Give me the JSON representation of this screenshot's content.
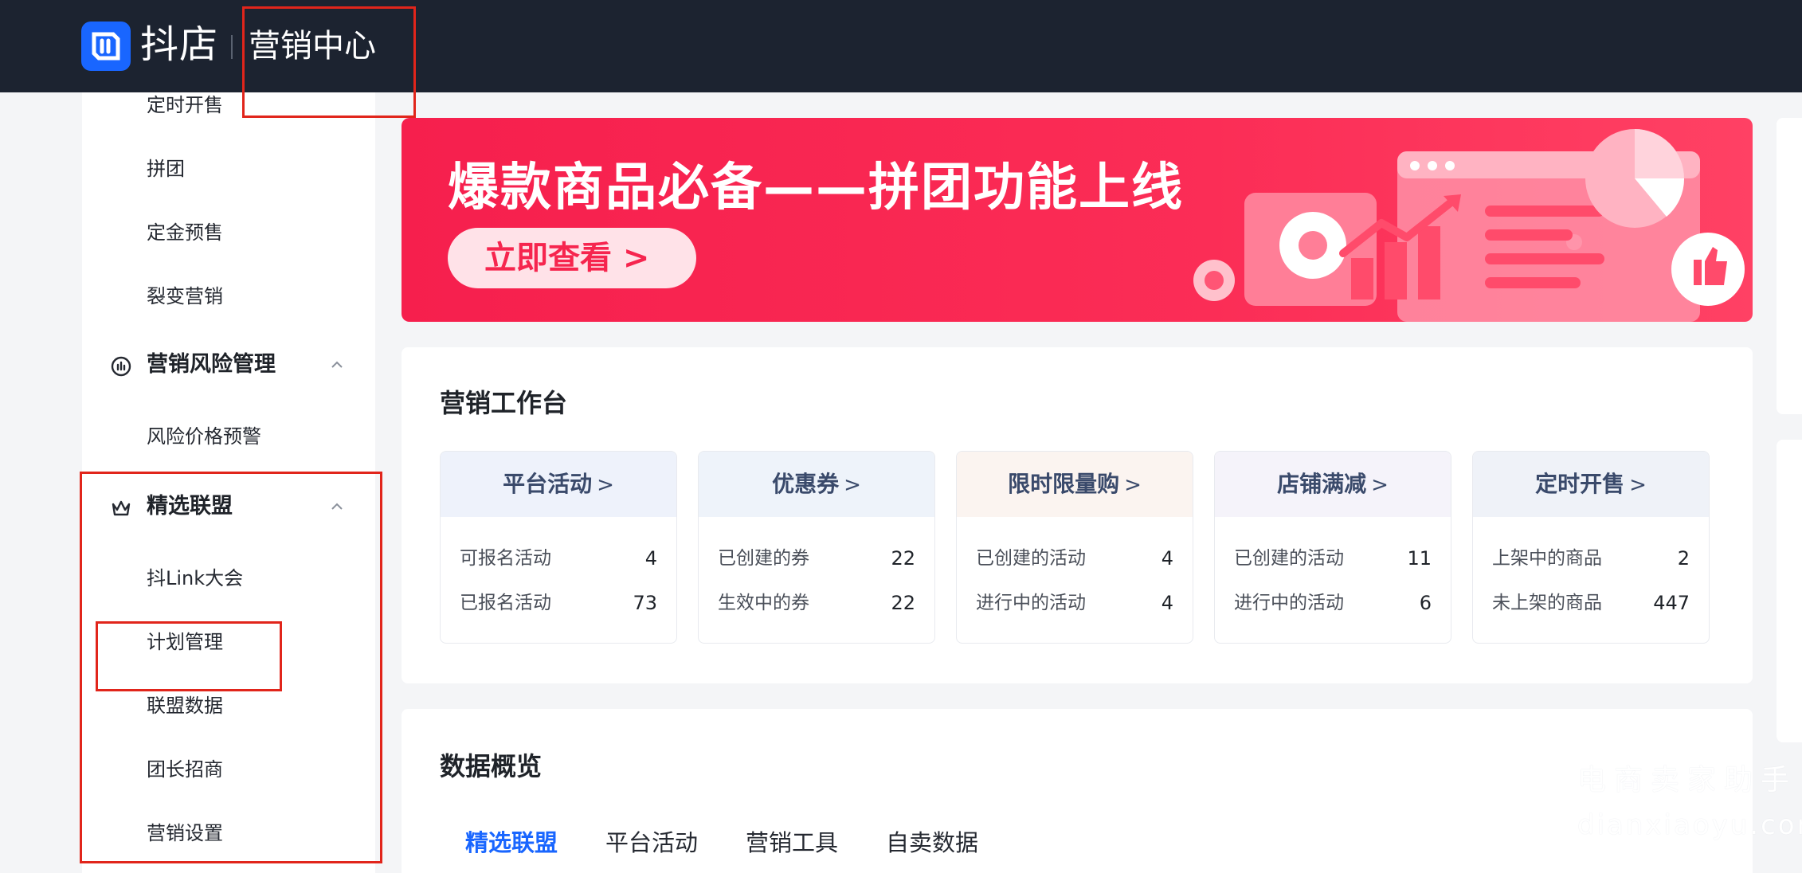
{
  "header": {
    "brand": "抖店",
    "section": "营销中心"
  },
  "sidebar": {
    "items_top": [
      "定时开售",
      "拼团",
      "定金预售",
      "裂变营销"
    ],
    "risk_group": {
      "label": "营销风险管理",
      "icon": "gauge-icon",
      "expanded": true
    },
    "risk_items": [
      "风险价格预警"
    ],
    "alliance_group": {
      "label": "精选联盟",
      "icon": "crown-icon",
      "expanded": true
    },
    "alliance_items": [
      "抖Link大会",
      "计划管理",
      "联盟数据",
      "团长招商",
      "营销设置"
    ]
  },
  "banner": {
    "title": "爆款商品必备——拼团功能上线",
    "button": "立即查看 >"
  },
  "workbench": {
    "title": "营销工作台",
    "tiles": [
      {
        "title": "平台活动",
        "rows": [
          {
            "label": "可报名活动",
            "value": "4"
          },
          {
            "label": "已报名活动",
            "value": "73"
          }
        ]
      },
      {
        "title": "优惠券",
        "rows": [
          {
            "label": "已创建的券",
            "value": "22"
          },
          {
            "label": "生效中的券",
            "value": "22"
          }
        ]
      },
      {
        "title": "限时限量购",
        "rows": [
          {
            "label": "已创建的活动",
            "value": "4"
          },
          {
            "label": "进行中的活动",
            "value": "4"
          }
        ]
      },
      {
        "title": "店铺满减",
        "rows": [
          {
            "label": "已创建的活动",
            "value": "11"
          },
          {
            "label": "进行中的活动",
            "value": "6"
          }
        ]
      },
      {
        "title": "定时开售",
        "rows": [
          {
            "label": "上架中的商品",
            "value": "2"
          },
          {
            "label": "未上架的商品",
            "value": "447"
          }
        ]
      }
    ]
  },
  "overview": {
    "title": "数据概览",
    "tabs": [
      "精选联盟",
      "平台活动",
      "营销工具",
      "自卖数据"
    ],
    "active_tab": "精选联盟"
  },
  "watermark": {
    "cn": "电商卖家助手",
    "en": "dianxiaoyu.com"
  },
  "colors": {
    "topbar": "#1c2330",
    "accent": "#1966ff",
    "banner": "#f61f4d",
    "highlight_box": "#e1251b"
  }
}
